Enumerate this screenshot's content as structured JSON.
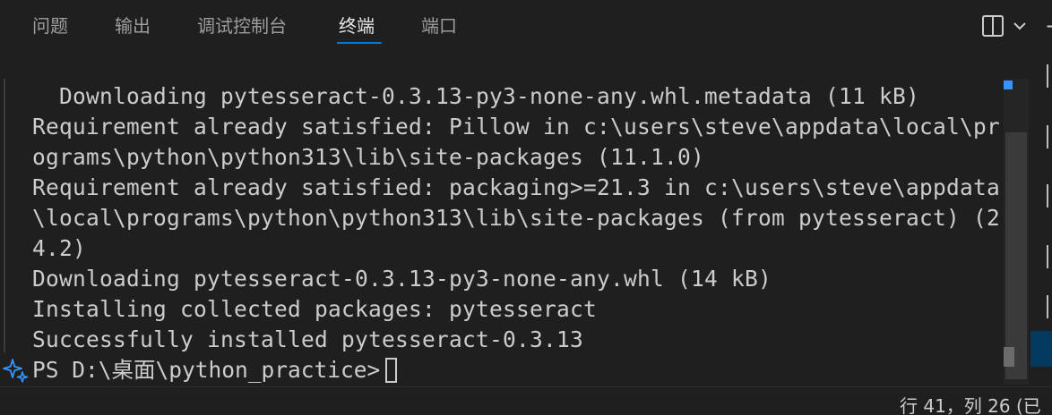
{
  "tabs": [
    {
      "label": "问题",
      "active": false
    },
    {
      "label": "输出",
      "active": false
    },
    {
      "label": "调试控制台",
      "active": false
    },
    {
      "label": "终端",
      "active": true
    },
    {
      "label": "端口",
      "active": false
    }
  ],
  "toolbar": {
    "split_icon": "split-panel-icon",
    "dropdown_icon": "chevron-down-icon",
    "add_icon": "plus-icon",
    "add_label": "+"
  },
  "terminal": {
    "lines": [
      "  Downloading pytesseract-0.3.13-py3-none-any.whl.metadata (11 kB)",
      "Requirement already satisfied: Pillow in c:\\users\\steve\\appdata\\local\\pr",
      "ograms\\python\\python313\\lib\\site-packages (11.1.0)",
      "Requirement already satisfied: packaging>=21.3 in c:\\users\\steve\\appdata",
      "\\local\\programs\\python\\python313\\lib\\site-packages (from pytesseract) (2",
      "4.2)",
      "Downloading pytesseract-0.3.13-py3-none-any.whl (14 kB)",
      "Installing collected packages: pytesseract",
      "Successfully installed pytesseract-0.3.13"
    ],
    "prompt": "PS D:\\桌面\\python_practice>",
    "prompt_icon": "sparkle-icon"
  },
  "status": {
    "position": "行 41，列 26 (已"
  },
  "colors": {
    "background": "#1f1f1f",
    "text": "#cccccc",
    "accent": "#0078d4",
    "sparkle": "#3794ff"
  }
}
